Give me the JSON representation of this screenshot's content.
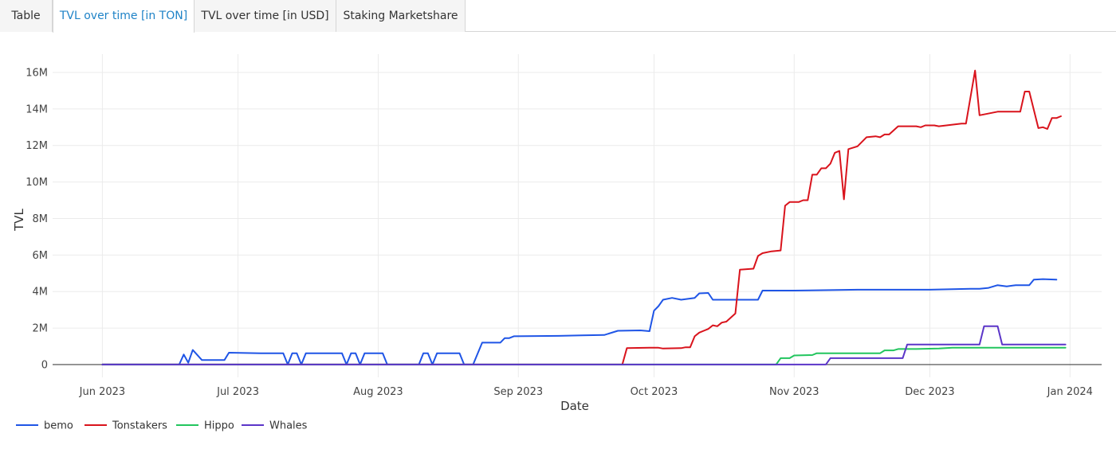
{
  "tabs": [
    {
      "label": "Table",
      "active": false
    },
    {
      "label": "TVL over time [in TON]",
      "active": true
    },
    {
      "label": "TVL over time [in USD]",
      "active": false
    },
    {
      "label": "Staking Marketshare",
      "active": false
    }
  ],
  "colors": {
    "accent": "#1f83c7",
    "bemo": "#1f55e6",
    "Tonstakers": "#d9131c",
    "Hippo": "#22c55e",
    "Whales": "#5b35c8"
  },
  "chart_data": {
    "type": "line",
    "title": "",
    "xlabel": "Date",
    "ylabel": "TVL",
    "x_range": [
      "2023-05-21",
      "2024-01-08"
    ],
    "y_range": [
      -700000,
      17000000
    ],
    "y_ticks": [
      0,
      2000000,
      4000000,
      6000000,
      8000000,
      10000000,
      12000000,
      14000000,
      16000000
    ],
    "y_tick_labels": [
      "0",
      "2M",
      "4M",
      "6M",
      "8M",
      "10M",
      "12M",
      "14M",
      "16M"
    ],
    "x_ticks": [
      "2023-06-01",
      "2023-07-01",
      "2023-08-01",
      "2023-09-01",
      "2023-10-01",
      "2023-11-01",
      "2023-12-01",
      "2024-01-01"
    ],
    "x_tick_labels": [
      "Jun 2023",
      "Jul 2023",
      "Aug 2023",
      "Sep 2023",
      "Oct 2023",
      "Nov 2023",
      "Dec 2023",
      "Jan 2024"
    ],
    "grid": true,
    "legend_position": "bottom-left",
    "series": [
      {
        "name": "bemo",
        "points": [
          [
            "2023-06-01",
            0
          ],
          [
            "2023-06-18",
            0
          ],
          [
            "2023-06-19",
            550000
          ],
          [
            "2023-06-20",
            100000
          ],
          [
            "2023-06-21",
            800000
          ],
          [
            "2023-06-23",
            250000
          ],
          [
            "2023-06-28",
            250000
          ],
          [
            "2023-06-29",
            650000
          ],
          [
            "2023-07-06",
            620000
          ],
          [
            "2023-07-11",
            620000
          ],
          [
            "2023-07-12",
            0
          ],
          [
            "2023-07-13",
            620000
          ],
          [
            "2023-07-14",
            620000
          ],
          [
            "2023-07-15",
            0
          ],
          [
            "2023-07-16",
            620000
          ],
          [
            "2023-07-24",
            620000
          ],
          [
            "2023-07-25",
            0
          ],
          [
            "2023-07-26",
            620000
          ],
          [
            "2023-07-27",
            620000
          ],
          [
            "2023-07-28",
            0
          ],
          [
            "2023-07-29",
            620000
          ],
          [
            "2023-08-02",
            620000
          ],
          [
            "2023-08-03",
            0
          ],
          [
            "2023-08-10",
            0
          ],
          [
            "2023-08-11",
            620000
          ],
          [
            "2023-08-12",
            620000
          ],
          [
            "2023-08-13",
            0
          ],
          [
            "2023-08-14",
            620000
          ],
          [
            "2023-08-19",
            620000
          ],
          [
            "2023-08-20",
            0
          ],
          [
            "2023-08-22",
            0
          ],
          [
            "2023-08-24",
            1200000
          ],
          [
            "2023-08-28",
            1200000
          ],
          [
            "2023-08-29",
            1450000
          ],
          [
            "2023-08-30",
            1450000
          ],
          [
            "2023-08-31",
            1550000
          ],
          [
            "2023-09-10",
            1570000
          ],
          [
            "2023-09-15",
            1600000
          ],
          [
            "2023-09-20",
            1620000
          ],
          [
            "2023-09-23",
            1850000
          ],
          [
            "2023-09-28",
            1870000
          ],
          [
            "2023-09-30",
            1830000
          ],
          [
            "2023-10-01",
            2950000
          ],
          [
            "2023-10-02",
            3200000
          ],
          [
            "2023-10-03",
            3550000
          ],
          [
            "2023-10-05",
            3650000
          ],
          [
            "2023-10-07",
            3550000
          ],
          [
            "2023-10-10",
            3650000
          ],
          [
            "2023-10-11",
            3900000
          ],
          [
            "2023-10-13",
            3920000
          ],
          [
            "2023-10-14",
            3550000
          ],
          [
            "2023-10-24",
            3550000
          ],
          [
            "2023-10-25",
            4050000
          ],
          [
            "2023-11-01",
            4050000
          ],
          [
            "2023-11-15",
            4100000
          ],
          [
            "2023-12-01",
            4100000
          ],
          [
            "2023-12-10",
            4150000
          ],
          [
            "2023-12-12",
            4150000
          ],
          [
            "2023-12-14",
            4200000
          ],
          [
            "2023-12-16",
            4350000
          ],
          [
            "2023-12-18",
            4280000
          ],
          [
            "2023-12-20",
            4350000
          ],
          [
            "2023-12-23",
            4350000
          ],
          [
            "2023-12-24",
            4650000
          ],
          [
            "2023-12-26",
            4680000
          ],
          [
            "2023-12-29",
            4650000
          ]
        ]
      },
      {
        "name": "Tonstakers",
        "points": [
          [
            "2023-06-01",
            0
          ],
          [
            "2023-09-24",
            0
          ],
          [
            "2023-09-25",
            900000
          ],
          [
            "2023-09-30",
            920000
          ],
          [
            "2023-10-02",
            920000
          ],
          [
            "2023-10-03",
            880000
          ],
          [
            "2023-10-07",
            900000
          ],
          [
            "2023-10-08",
            950000
          ],
          [
            "2023-10-09",
            950000
          ],
          [
            "2023-10-10",
            1550000
          ],
          [
            "2023-10-11",
            1750000
          ],
          [
            "2023-10-12",
            1850000
          ],
          [
            "2023-10-13",
            1950000
          ],
          [
            "2023-10-14",
            2150000
          ],
          [
            "2023-10-15",
            2100000
          ],
          [
            "2023-10-16",
            2300000
          ],
          [
            "2023-10-17",
            2350000
          ],
          [
            "2023-10-19",
            2800000
          ],
          [
            "2023-10-20",
            5200000
          ],
          [
            "2023-10-23",
            5250000
          ],
          [
            "2023-10-24",
            5950000
          ],
          [
            "2023-10-25",
            6100000
          ],
          [
            "2023-10-27",
            6200000
          ],
          [
            "2023-10-29",
            6250000
          ],
          [
            "2023-10-30",
            8700000
          ],
          [
            "2023-10-31",
            8900000
          ],
          [
            "2023-11-02",
            8900000
          ],
          [
            "2023-11-03",
            9000000
          ],
          [
            "2023-11-04",
            9000000
          ],
          [
            "2023-11-05",
            10400000
          ],
          [
            "2023-11-06",
            10400000
          ],
          [
            "2023-11-07",
            10750000
          ],
          [
            "2023-11-08",
            10750000
          ],
          [
            "2023-11-09",
            11000000
          ],
          [
            "2023-11-10",
            11600000
          ],
          [
            "2023-11-11",
            11700000
          ],
          [
            "2023-11-12",
            9050000
          ],
          [
            "2023-11-13",
            11800000
          ],
          [
            "2023-11-15",
            11950000
          ],
          [
            "2023-11-17",
            12450000
          ],
          [
            "2023-11-19",
            12500000
          ],
          [
            "2023-11-20",
            12450000
          ],
          [
            "2023-11-21",
            12600000
          ],
          [
            "2023-11-22",
            12600000
          ],
          [
            "2023-11-24",
            13050000
          ],
          [
            "2023-11-28",
            13050000
          ],
          [
            "2023-11-29",
            13000000
          ],
          [
            "2023-11-30",
            13100000
          ],
          [
            "2023-12-02",
            13100000
          ],
          [
            "2023-12-03",
            13050000
          ],
          [
            "2023-12-08",
            13200000
          ],
          [
            "2023-12-09",
            13200000
          ],
          [
            "2023-12-11",
            16100000
          ],
          [
            "2023-12-12",
            13650000
          ],
          [
            "2023-12-13",
            13700000
          ],
          [
            "2023-12-16",
            13850000
          ],
          [
            "2023-12-19",
            13850000
          ],
          [
            "2023-12-21",
            13850000
          ],
          [
            "2023-12-22",
            14950000
          ],
          [
            "2023-12-23",
            14950000
          ],
          [
            "2023-12-25",
            12950000
          ],
          [
            "2023-12-26",
            13000000
          ],
          [
            "2023-12-27",
            12900000
          ],
          [
            "2023-12-28",
            13500000
          ],
          [
            "2023-12-29",
            13500000
          ],
          [
            "2023-12-30",
            13600000
          ]
        ]
      },
      {
        "name": "Hippo",
        "points": [
          [
            "2023-06-01",
            0
          ],
          [
            "2023-10-28",
            0
          ],
          [
            "2023-10-29",
            350000
          ],
          [
            "2023-10-31",
            350000
          ],
          [
            "2023-11-01",
            500000
          ],
          [
            "2023-11-05",
            520000
          ],
          [
            "2023-11-06",
            620000
          ],
          [
            "2023-11-20",
            620000
          ],
          [
            "2023-11-21",
            780000
          ],
          [
            "2023-11-23",
            780000
          ],
          [
            "2023-11-24",
            850000
          ],
          [
            "2023-11-28",
            850000
          ],
          [
            "2023-12-03",
            880000
          ],
          [
            "2023-12-06",
            920000
          ],
          [
            "2023-12-31",
            920000
          ]
        ]
      },
      {
        "name": "Whales",
        "points": [
          [
            "2023-06-01",
            0
          ],
          [
            "2023-11-08",
            0
          ],
          [
            "2023-11-09",
            350000
          ],
          [
            "2023-11-25",
            350000
          ],
          [
            "2023-11-26",
            1100000
          ],
          [
            "2023-12-01",
            1100000
          ],
          [
            "2023-12-09",
            1100000
          ],
          [
            "2023-12-10",
            1100000
          ],
          [
            "2023-12-11",
            1100000
          ],
          [
            "2023-12-12",
            1100000
          ],
          [
            "2023-12-13",
            2100000
          ],
          [
            "2023-12-16",
            2100000
          ],
          [
            "2023-12-17",
            1100000
          ],
          [
            "2023-12-31",
            1100000
          ]
        ]
      }
    ]
  }
}
